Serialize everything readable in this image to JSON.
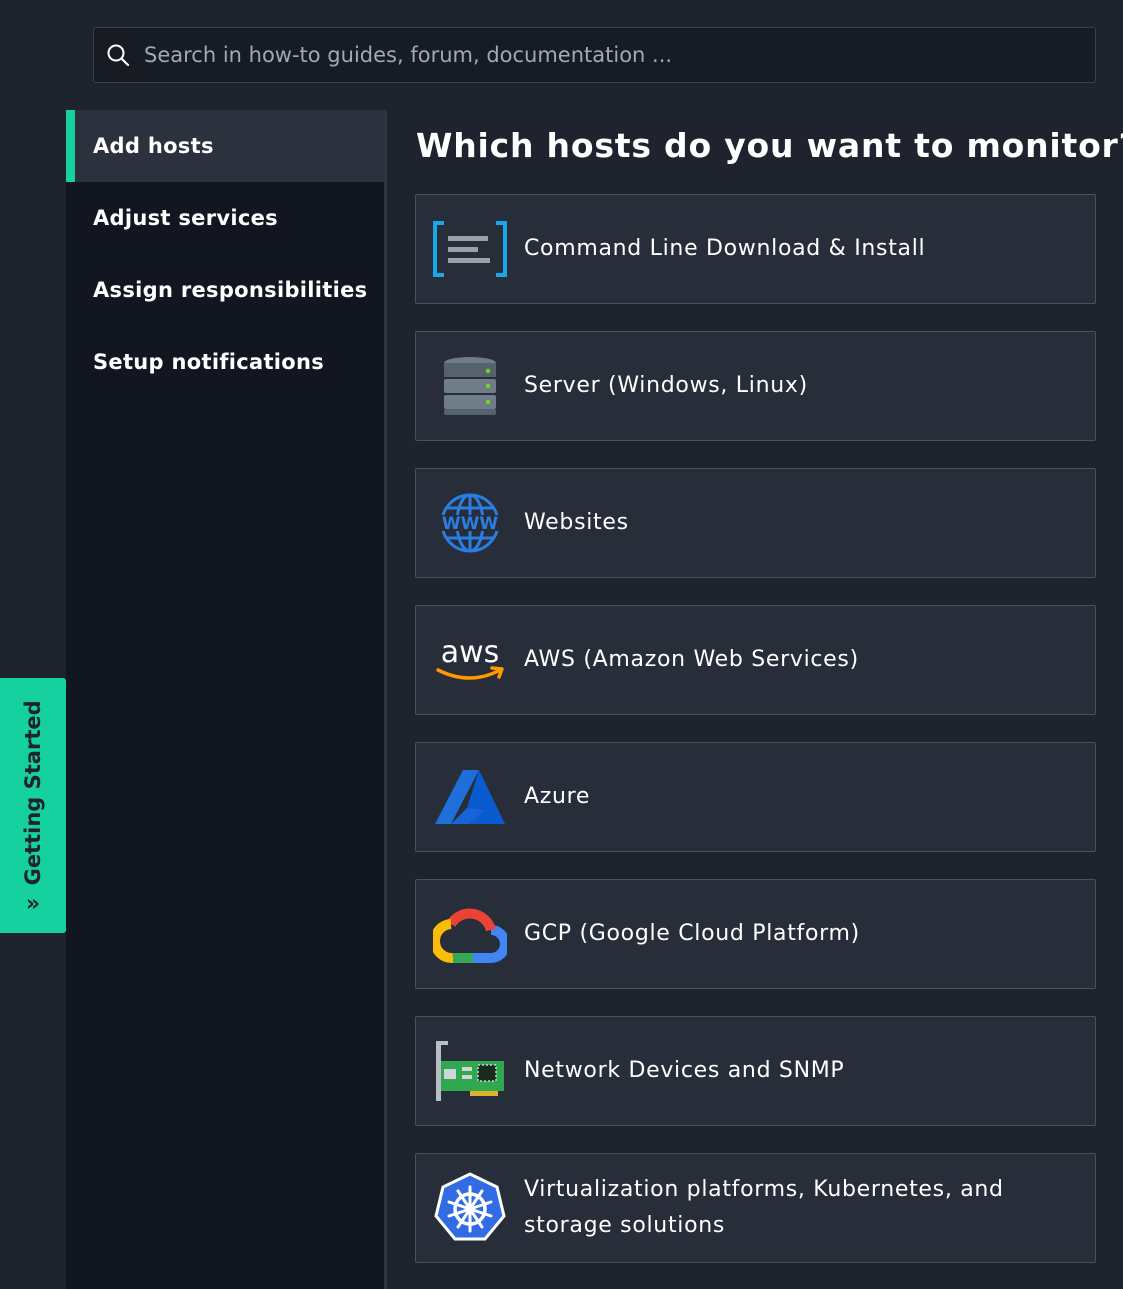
{
  "search": {
    "placeholder": "Search in how-to guides, forum, documentation ..."
  },
  "getting_started_tab": {
    "label": "Getting Started",
    "icon": "chevron-double-right-icon",
    "color": "#15d1a0"
  },
  "nav": {
    "items": [
      {
        "label": "Add hosts",
        "active": true
      },
      {
        "label": "Adjust services",
        "active": false
      },
      {
        "label": "Assign responsibilities",
        "active": false
      },
      {
        "label": "Setup notifications",
        "active": false
      }
    ]
  },
  "main": {
    "title": "Which hosts do you want to monitor?",
    "hosts": [
      {
        "label": "Command Line Download & Install",
        "icon": "command-line-icon"
      },
      {
        "label": "Server (Windows, Linux)",
        "icon": "server-icon"
      },
      {
        "label": "Websites",
        "icon": "globe-www-icon"
      },
      {
        "label": "AWS (Amazon Web Services)",
        "icon": "aws-logo-icon"
      },
      {
        "label": "Azure",
        "icon": "azure-logo-icon"
      },
      {
        "label": "GCP (Google Cloud Platform)",
        "icon": "gcp-logo-icon"
      },
      {
        "label": "Network Devices and SNMP",
        "icon": "network-card-icon"
      },
      {
        "label": "Virtualization platforms, Kubernetes, and storage solutions",
        "icon": "kubernetes-icon"
      }
    ]
  },
  "colors": {
    "accent": "#15d1a0",
    "background": "#1e232d",
    "nav_background": "#111620",
    "card_background": "#272d39"
  },
  "logos": {
    "aws_wordmark": "aws",
    "www_text": "WWW"
  }
}
